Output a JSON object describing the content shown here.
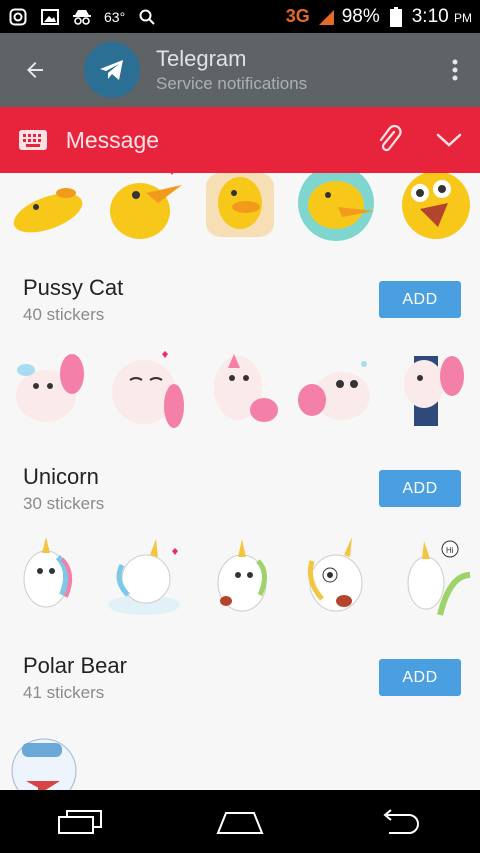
{
  "status_bar": {
    "temperature": "63°",
    "network": "3G",
    "battery": "98%",
    "time": "3:10",
    "ampm": "PM",
    "net_color": "#e46a25"
  },
  "header": {
    "title": "Telegram",
    "subtitle": "Service notifications",
    "back_icon": "arrow-left-icon",
    "menu_icon": "more-vert-icon"
  },
  "composer": {
    "placeholder": "Message",
    "accent": "#e8243d"
  },
  "sticker_packs": [
    {
      "name": "Pussy Cat",
      "count": "40 stickers",
      "add_label": "ADD"
    },
    {
      "name": "Unicorn",
      "count": "30 stickers",
      "add_label": "ADD"
    },
    {
      "name": "Polar Bear",
      "count": "41 stickers",
      "add_label": "ADD"
    }
  ],
  "colors": {
    "add_button": "#4a9fe0",
    "app_bar": "#5e6366"
  }
}
